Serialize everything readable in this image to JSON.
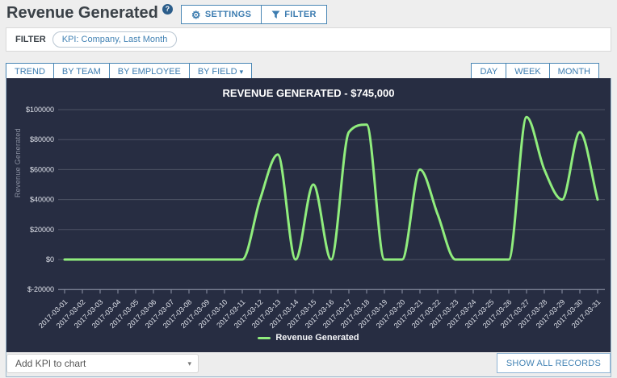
{
  "header": {
    "title": "Revenue Generated",
    "help_glyph": "?",
    "settings_label": "SETTINGS",
    "filter_label": "FILTER",
    "gear_glyph": "⚙"
  },
  "filter_bar": {
    "label": "FILTER",
    "chips": [
      "KPI: Company, Last Month"
    ]
  },
  "tabs": {
    "left": [
      "TREND",
      "BY TEAM",
      "BY EMPLOYEE",
      "BY FIELD"
    ],
    "right": [
      "DAY",
      "WEEK",
      "MONTH"
    ],
    "caret_glyph": "▾"
  },
  "chart_data": {
    "type": "line",
    "title": "REVENUE GENERATED - $745,000",
    "total_label": "$745,000",
    "ylabel": "Revenue Generated",
    "xlabel": "",
    "legend": [
      "Revenue Generated"
    ],
    "legend_position": "bottom",
    "grid": true,
    "ylim": [
      -20000,
      100000
    ],
    "ytick_step": 20000,
    "ytick_prefix": "$",
    "categories": [
      "2017-03-01",
      "2017-03-02",
      "2017-03-03",
      "2017-03-04",
      "2017-03-05",
      "2017-03-06",
      "2017-03-07",
      "2017-03-08",
      "2017-03-09",
      "2017-03-10",
      "2017-03-11",
      "2017-03-12",
      "2017-03-13",
      "2017-03-14",
      "2017-03-15",
      "2017-03-16",
      "2017-03-17",
      "2017-03-18",
      "2017-03-19",
      "2017-03-20",
      "2017-03-21",
      "2017-03-22",
      "2017-03-23",
      "2017-03-24",
      "2017-03-25",
      "2017-03-26",
      "2017-03-27",
      "2017-03-28",
      "2017-03-29",
      "2017-03-30",
      "2017-03-31"
    ],
    "values": [
      0,
      0,
      0,
      0,
      0,
      0,
      0,
      0,
      0,
      0,
      0,
      40000,
      70000,
      0,
      50000,
      0,
      85000,
      90000,
      0,
      0,
      60000,
      30000,
      0,
      0,
      0,
      0,
      95000,
      60000,
      40000,
      85000,
      40000
    ],
    "line_color": "#90ed7d",
    "background": "#272d42",
    "grid_color": "rgba(255,255,255,0.18)",
    "axis_color": "#8f95a8",
    "label_color": "#dfe2ea"
  },
  "footer": {
    "add_kpi_label": "Add KPI to chart",
    "show_all_label": "SHOW ALL RECORDS",
    "caret_glyph": "▾"
  },
  "colors": {
    "accent_text": "#3c7cb0",
    "accent_border": "#4a87b5",
    "page_bg": "#eeeeee"
  }
}
